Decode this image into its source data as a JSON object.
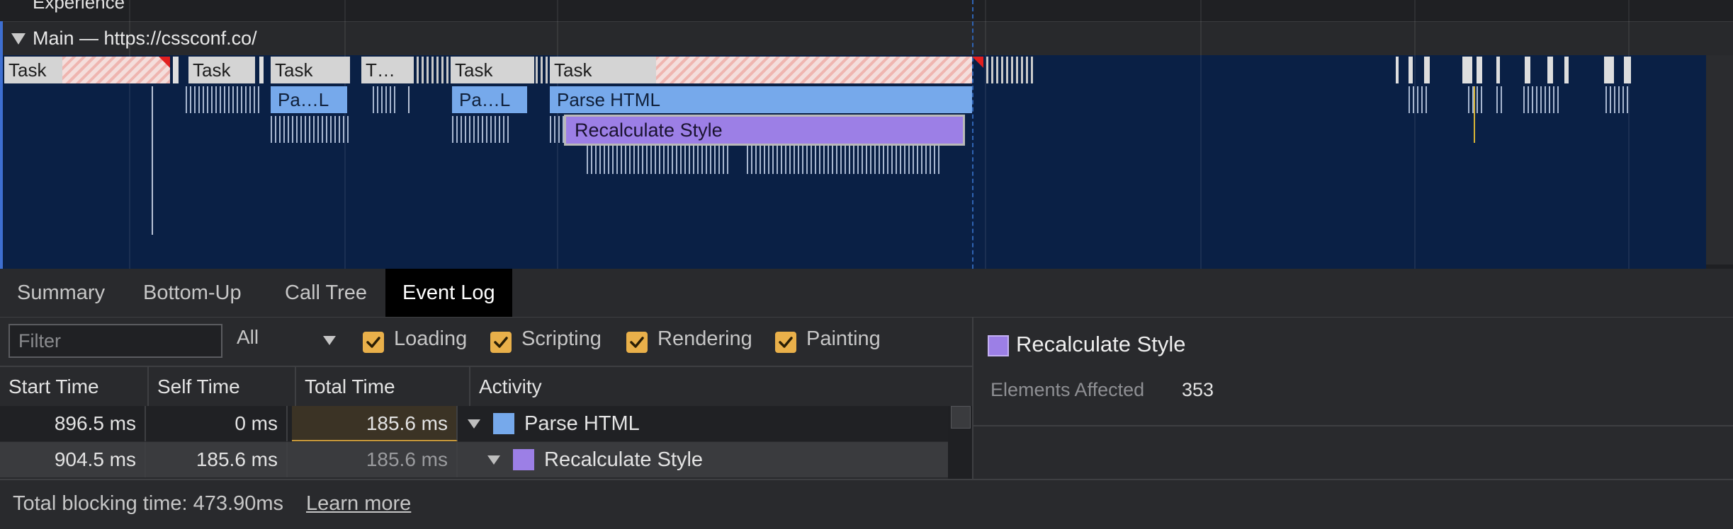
{
  "flame": {
    "experience_label": "Experience",
    "main_thread_label": "Main — https://cssconf.co/",
    "tasks": [
      "Task",
      "Task",
      "Task",
      "T…",
      "Task",
      "Task"
    ],
    "parse_short": [
      "Pa…L",
      "Pa…L"
    ],
    "parse_html": "Parse HTML",
    "recalculate_style": "Recalculate Style",
    "colors": {
      "task": "#d4d4d4",
      "loading": "#76a9eb",
      "rendering": "#9c7fe6",
      "long_task_flag": "#e21f1f"
    }
  },
  "tabs": [
    {
      "label": "Summary",
      "active": false
    },
    {
      "label": "Bottom-Up",
      "active": false
    },
    {
      "label": "Call Tree",
      "active": false
    },
    {
      "label": "Event Log",
      "active": true
    }
  ],
  "filters": {
    "filter_placeholder": "Filter",
    "filter_value": "",
    "type_selected": "All",
    "categories": [
      {
        "label": "Loading",
        "checked": true
      },
      {
        "label": "Scripting",
        "checked": true
      },
      {
        "label": "Rendering",
        "checked": true
      },
      {
        "label": "Painting",
        "checked": true
      }
    ]
  },
  "table": {
    "columns": [
      "Start Time",
      "Self Time",
      "Total Time",
      "Activity"
    ],
    "rows": [
      {
        "start": "896.5 ms",
        "self": "0 ms",
        "total": "185.6 ms",
        "activity": "Parse HTML",
        "color": "#76a9eb"
      },
      {
        "start": "904.5 ms",
        "self": "185.6 ms",
        "total": "185.6 ms",
        "activity": "Recalculate Style",
        "color": "#9c7fe6"
      }
    ]
  },
  "details": {
    "title": "Recalculate Style",
    "key": "Elements Affected",
    "value": "353"
  },
  "footer": {
    "text": "Total blocking time: 473.90ms",
    "link": "Learn more"
  }
}
